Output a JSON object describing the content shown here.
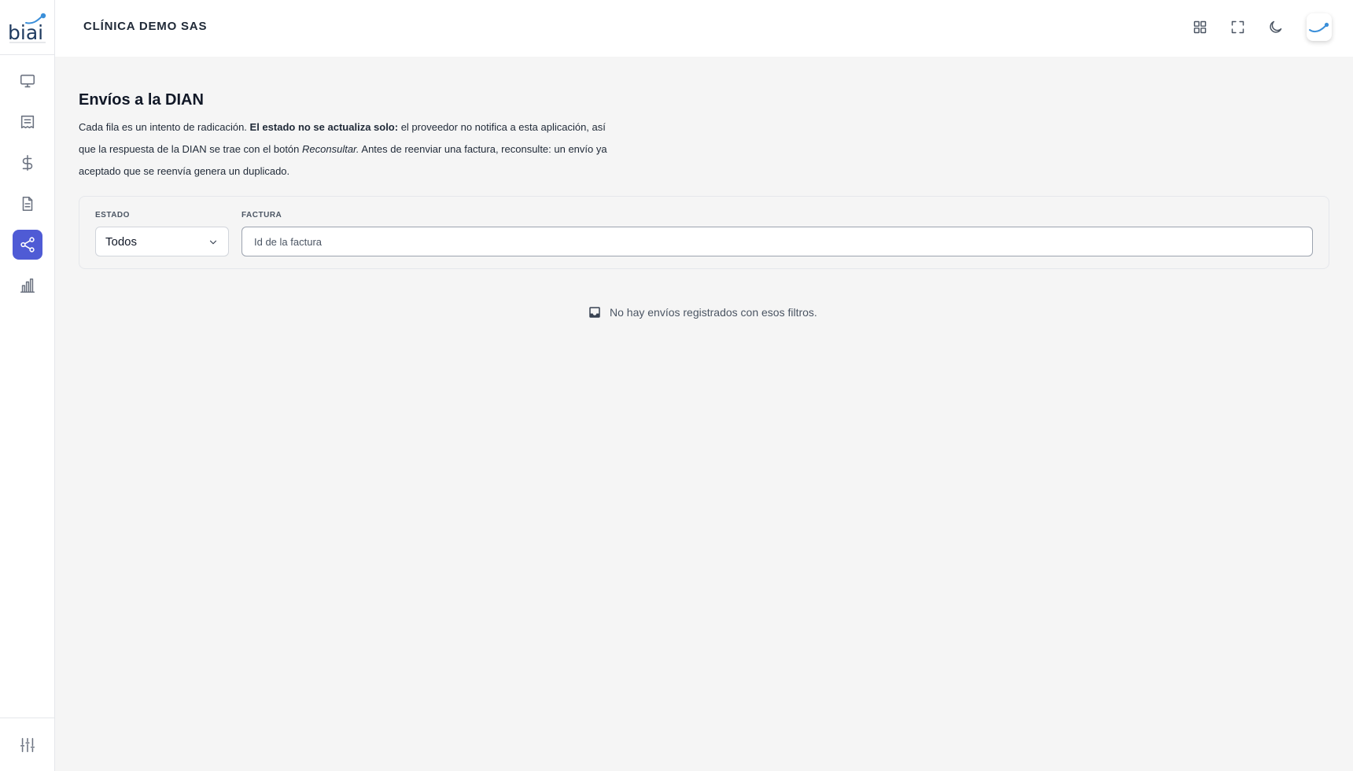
{
  "app": {
    "logo_text": "biai"
  },
  "header": {
    "org_name": "CLÍNICA DEMO SAS",
    "icons": [
      "apps-grid-icon",
      "fullscreen-icon",
      "dark-mode-icon",
      "user-avatar"
    ]
  },
  "sidebar": {
    "items": [
      {
        "name": "monitor-icon",
        "active": false
      },
      {
        "name": "receipt-icon",
        "active": false
      },
      {
        "name": "dollar-icon",
        "active": false
      },
      {
        "name": "document-icon",
        "active": false
      },
      {
        "name": "share-icon",
        "active": true
      },
      {
        "name": "bar-chart-icon",
        "active": false
      }
    ],
    "bottom_icon": "sliders-icon"
  },
  "page": {
    "title": "Envíos a la DIAN",
    "intro": {
      "part1": "Cada fila es un intento de radicación. ",
      "bold": "El estado no se actualiza solo:",
      "part2": " el proveedor no notifica a esta aplicación, así que la respuesta de la DIAN se trae con el botón ",
      "italic": "Reconsultar.",
      "part3": " Antes de reenviar una factura, reconsulte: un envío ya aceptado que se reenvía genera un duplicado."
    }
  },
  "filters": {
    "estado_label": "ESTADO",
    "estado_value": "Todos",
    "factura_label": "FACTURA",
    "factura_placeholder": "Id de la factura",
    "factura_value": ""
  },
  "empty_state": {
    "message": "No hay envíos registrados con esos filtros."
  },
  "colors": {
    "accent": "#4f5bd5",
    "background": "#f5f5f5",
    "logo_dark": "#1e3a5f",
    "logo_light": "#3b8fd9"
  }
}
